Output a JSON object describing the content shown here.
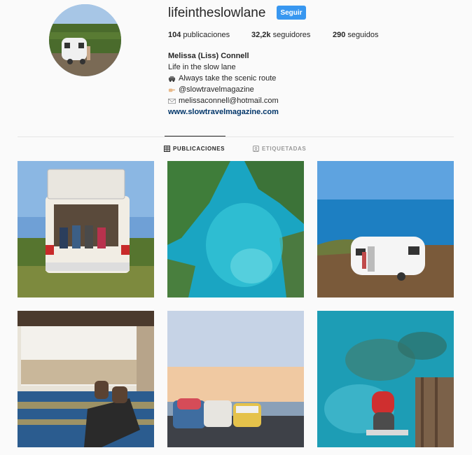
{
  "profile": {
    "username": "lifeintheslowlane",
    "follow_label": "Seguir",
    "stats": {
      "posts": "104",
      "posts_label": "publicaciones",
      "followers": "32,2k",
      "followers_label": "seguidores",
      "following": "290",
      "following_label": "seguidos"
    },
    "bio": {
      "full_name": "Melissa (Liss) Connell",
      "tagline": "Life in the slow lane",
      "line_scenic": "Always take the scenic route",
      "line_magazine": "@slowtravelmagazine",
      "line_email": "melissaconnell@hotmail.com",
      "website": "www.slowtravelmagazine.com"
    },
    "icons": [
      "car-emoji-icon",
      "pointing-hand-icon",
      "envelope-icon"
    ]
  },
  "tabs": {
    "posts_label": "PUBLICACIONES",
    "tagged_label": "ETIQUETADAS"
  },
  "colors": {
    "follow_button": "#3897f0",
    "link": "#003569",
    "background": "#fafafa"
  },
  "posts": [
    {
      "subject": "van-open-back"
    },
    {
      "subject": "aerial-lagoon"
    },
    {
      "subject": "caravan-by-sea"
    },
    {
      "subject": "van-interior-view"
    },
    {
      "subject": "three-vw-vans-sunset"
    },
    {
      "subject": "girl-on-ladder-reef"
    }
  ]
}
